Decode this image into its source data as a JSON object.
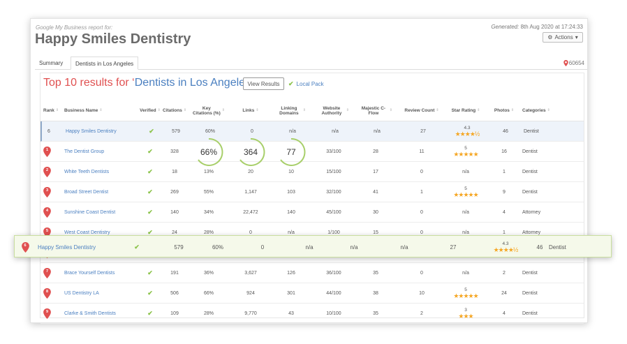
{
  "header": {
    "subtitle": "Google My Business report for:",
    "title": "Happy Smiles Dentistry",
    "generated_label": "Generated:",
    "generated_value": "8th Aug 2020 at 17:24:33",
    "actions_label": "Actions"
  },
  "tabs": [
    {
      "label": "Summary"
    },
    {
      "label": "Dentists in Los Angeles"
    }
  ],
  "location_count": "60654",
  "report": {
    "heading_prefix": "Top 10 results for ‘",
    "heading_query": "Dentists in Los Angeles",
    "heading_suffix": "’",
    "view_results_label": "View Results",
    "local_pack_label": "Local Pack"
  },
  "columns": [
    "Rank",
    "Business Name",
    "Verified",
    "Citations",
    "Key Citations (%)",
    "Links",
    "Linking Domains",
    "Website Authority",
    "Majestic C-Flow",
    "Review Count",
    "Star Rating",
    "Photos",
    "Categories"
  ],
  "rows": [
    {
      "rank": "6",
      "name": "Happy Smiles Dentistry",
      "citations": "579",
      "key": "60%",
      "links": "0",
      "domains": "n/a",
      "authority": "n/a",
      "cflow": "n/a",
      "reviews": "27",
      "rating": "4.3",
      "stars": "★★★★½",
      "photos": "46",
      "category": "Dentist"
    },
    {
      "rank": "1",
      "name": "The Dentist Group",
      "citations": "328",
      "key": "66%",
      "links": "364",
      "domains": "77",
      "authority": "33/100",
      "cflow": "28",
      "reviews": "11",
      "rating": "5",
      "stars": "★★★★★",
      "photos": "16",
      "category": "Dentist"
    },
    {
      "rank": "2",
      "name": "White Teeth Dentists",
      "citations": "18",
      "key": "13%",
      "links": "20",
      "domains": "10",
      "authority": "15/100",
      "cflow": "17",
      "reviews": "0",
      "rating": "n/a",
      "stars": "",
      "photos": "1",
      "category": "Dentist"
    },
    {
      "rank": "3",
      "name": "Broad Street Dentist",
      "citations": "269",
      "key": "55%",
      "links": "1,147",
      "domains": "103",
      "authority": "32/100",
      "cflow": "41",
      "reviews": "1",
      "rating": "5",
      "stars": "★★★★★",
      "photos": "9",
      "category": "Dentist"
    },
    {
      "rank": "4",
      "name": "Sunshine Coast Dentist",
      "citations": "140",
      "key": "34%",
      "links": "22,472",
      "domains": "140",
      "authority": "45/100",
      "cflow": "30",
      "reviews": "0",
      "rating": "n/a",
      "stars": "",
      "photos": "4",
      "category": "Attorney"
    },
    {
      "rank": "5",
      "name": "West Coast Dentistry",
      "citations": "24",
      "key": "28%",
      "links": "0",
      "domains": "n/a",
      "authority": "1/100",
      "cflow": "15",
      "reviews": "0",
      "rating": "n/a",
      "stars": "",
      "photos": "1",
      "category": "Attorney"
    },
    {
      "rank": "6",
      "name": "Happy Smiles Dentistry",
      "citations": "579",
      "key": "60%",
      "links": "0",
      "domains": "n/a",
      "authority": "n/a",
      "cflow": "n/a",
      "reviews": "27",
      "rating": "4.3",
      "stars": "★★★★½",
      "photos": "46",
      "category": "Dentist"
    },
    {
      "rank": "7",
      "name": "Brace Yourself Dentists",
      "citations": "191",
      "key": "36%",
      "links": "3,627",
      "domains": "126",
      "authority": "36/100",
      "cflow": "35",
      "reviews": "0",
      "rating": "n/a",
      "stars": "",
      "photos": "2",
      "category": "Dentist"
    },
    {
      "rank": "8",
      "name": "US Dentistry LA",
      "citations": "506",
      "key": "66%",
      "links": "924",
      "domains": "301",
      "authority": "44/100",
      "cflow": "38",
      "reviews": "10",
      "rating": "5",
      "stars": "★★★★★",
      "photos": "24",
      "category": "Dentist"
    },
    {
      "rank": "9",
      "name": "Clarke & Smith Dentists",
      "citations": "109",
      "key": "28%",
      "links": "9,770",
      "domains": "43",
      "authority": "10/100",
      "cflow": "35",
      "reviews": "2",
      "rating": "3",
      "stars": "★★★",
      "photos": "4",
      "category": "Dentist"
    }
  ],
  "colors": {
    "accent_red": "#e05050",
    "link_blue": "#4a7fc0",
    "check_green": "#8bc34a",
    "star_gold": "#f5a623"
  }
}
